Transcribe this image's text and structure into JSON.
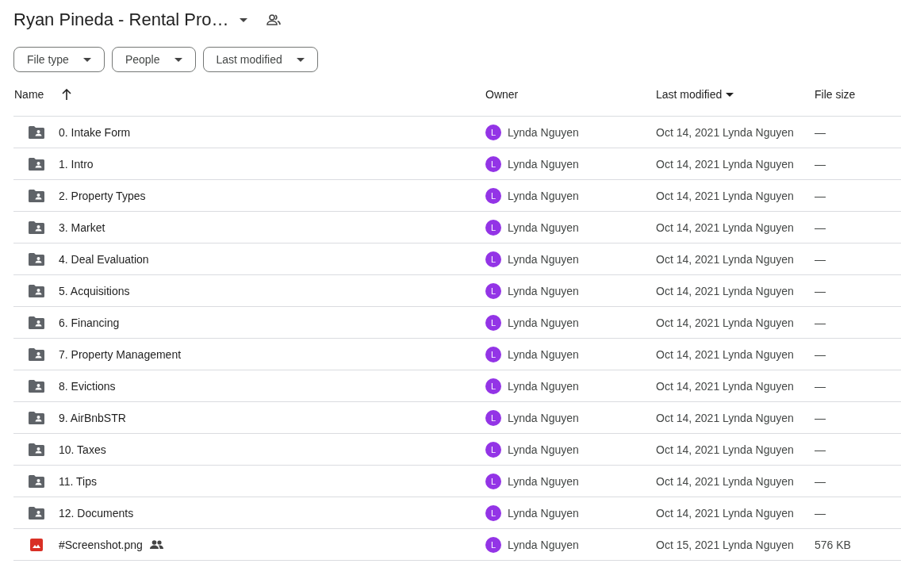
{
  "title": "Ryan Pineda - Rental Pro…",
  "filters": [
    "File type",
    "People",
    "Last modified"
  ],
  "columns": [
    {
      "label": "Name",
      "kind": "ascending"
    },
    {
      "label": "Owner",
      "kind": "plain"
    },
    {
      "label": "Last modified",
      "kind": "descending"
    },
    {
      "label": "File size",
      "kind": "plain"
    }
  ],
  "rows": [
    {
      "kind": "folder",
      "name": "0. Intake Form",
      "shared": false,
      "avatar": "L",
      "owner": "Lynda Nguyen",
      "modified": "Oct 14, 2021 Lynda Nguyen",
      "size": "—"
    },
    {
      "kind": "folder",
      "name": "1. Intro",
      "shared": false,
      "avatar": "L",
      "owner": "Lynda Nguyen",
      "modified": "Oct 14, 2021 Lynda Nguyen",
      "size": "—"
    },
    {
      "kind": "folder",
      "name": "2. Property Types",
      "shared": false,
      "avatar": "L",
      "owner": "Lynda Nguyen",
      "modified": "Oct 14, 2021 Lynda Nguyen",
      "size": "—"
    },
    {
      "kind": "folder",
      "name": "3. Market",
      "shared": false,
      "avatar": "L",
      "owner": "Lynda Nguyen",
      "modified": "Oct 14, 2021 Lynda Nguyen",
      "size": "—"
    },
    {
      "kind": "folder",
      "name": "4. Deal Evaluation",
      "shared": false,
      "avatar": "L",
      "owner": "Lynda Nguyen",
      "modified": "Oct 14, 2021 Lynda Nguyen",
      "size": "—"
    },
    {
      "kind": "folder",
      "name": "5. Acquisitions",
      "shared": false,
      "avatar": "L",
      "owner": "Lynda Nguyen",
      "modified": "Oct 14, 2021 Lynda Nguyen",
      "size": "—"
    },
    {
      "kind": "folder",
      "name": "6. Financing",
      "shared": false,
      "avatar": "L",
      "owner": "Lynda Nguyen",
      "modified": "Oct 14, 2021 Lynda Nguyen",
      "size": "—"
    },
    {
      "kind": "folder",
      "name": "7. Property Management",
      "shared": false,
      "avatar": "L",
      "owner": "Lynda Nguyen",
      "modified": "Oct 14, 2021 Lynda Nguyen",
      "size": "—"
    },
    {
      "kind": "folder",
      "name": "8. Evictions",
      "shared": false,
      "avatar": "L",
      "owner": "Lynda Nguyen",
      "modified": "Oct 14, 2021 Lynda Nguyen",
      "size": "—"
    },
    {
      "kind": "folder",
      "name": "9. AirBnbSTR",
      "shared": false,
      "avatar": "L",
      "owner": "Lynda Nguyen",
      "modified": "Oct 14, 2021 Lynda Nguyen",
      "size": "—"
    },
    {
      "kind": "folder",
      "name": "10. Taxes",
      "shared": false,
      "avatar": "L",
      "owner": "Lynda Nguyen",
      "modified": "Oct 14, 2021 Lynda Nguyen",
      "size": "—"
    },
    {
      "kind": "folder",
      "name": "11. Tips",
      "shared": false,
      "avatar": "L",
      "owner": "Lynda Nguyen",
      "modified": "Oct 14, 2021 Lynda Nguyen",
      "size": "—"
    },
    {
      "kind": "folder",
      "name": "12. Documents",
      "shared": false,
      "avatar": "L",
      "owner": "Lynda Nguyen",
      "modified": "Oct 14, 2021 Lynda Nguyen",
      "size": "—"
    },
    {
      "kind": "image",
      "name": "#Screenshot.png",
      "shared": true,
      "avatar": "L",
      "owner": "Lynda Nguyen",
      "modified": "Oct 15, 2021 Lynda Nguyen",
      "size": "576 KB"
    }
  ]
}
